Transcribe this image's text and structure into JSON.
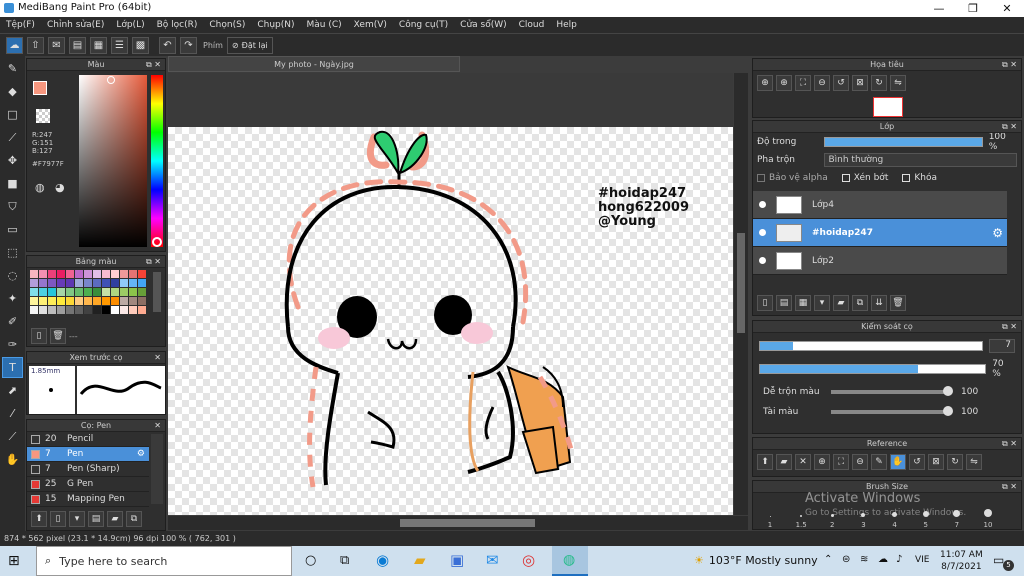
{
  "window": {
    "title": "MediBang Paint Pro (64bit)",
    "min": "—",
    "max": "❐",
    "close": "✕"
  },
  "menu": [
    "Tệp(F)",
    "Chỉnh sửa(E)",
    "Lớp(L)",
    "Bộ lọc(R)",
    "Chọn(S)",
    "Chụp(N)",
    "Màu (C)",
    "Xem(V)",
    "Công cụ(T)",
    "Cửa sổ(W)",
    "Cloud",
    "Help"
  ],
  "toolbar": {
    "phim": "Phím",
    "reset": "Đặt lại"
  },
  "color_panel": {
    "title": "Màu",
    "r": "R:247",
    "g": "G:151",
    "b": "B:127",
    "hex": "#F7977F",
    "primary": "#F7977F"
  },
  "palette_panel": {
    "title": "Bảng màu",
    "more": "---"
  },
  "preview_panel": {
    "title": "Xem trước cọ",
    "size": "1.85mm"
  },
  "brush_panel": {
    "title": "Cọ: Pen",
    "items": [
      {
        "size": "20",
        "name": "Pencil",
        "color": "#333"
      },
      {
        "size": "7",
        "name": "Pen",
        "color": "#F7977F"
      },
      {
        "size": "7",
        "name": "Pen (Sharp)",
        "color": "#333"
      },
      {
        "size": "25",
        "name": "G Pen",
        "color": "#e53935"
      },
      {
        "size": "15",
        "name": "Mapping Pen",
        "color": "#e53935"
      }
    ],
    "selected": 1
  },
  "document": {
    "tab": "My photo - Ngày.jpg"
  },
  "canvas": {
    "text1": "#hoidap247",
    "text2": "hong622009",
    "text3": "@Young"
  },
  "navigator": {
    "title": "Họa tiêu"
  },
  "layer_panel": {
    "title": "Lớp",
    "opacity_label": "Độ trong",
    "opacity_value": "100 %",
    "blend_label": "Pha trộn",
    "blend_value": "Bình thường",
    "protect_alpha": "Bảo vệ alpha",
    "clipping": "Xén bớt",
    "lock": "Khóa",
    "layers": [
      {
        "name": "Lớp4",
        "selected": false
      },
      {
        "name": "#hoidap247",
        "selected": true
      },
      {
        "name": "Lớp2",
        "selected": false
      }
    ]
  },
  "brush_control": {
    "title": "Kiểm soát cọ",
    "size_value": "7",
    "opacity_value": "70 %",
    "size_fill": 0.15,
    "opacity_fill": 0.7,
    "blend_label": "Dễ trộn màu",
    "blend_value": "100",
    "color_label": "Tài màu",
    "color_value": "100"
  },
  "reference": {
    "title": "Reference"
  },
  "brush_size": {
    "title": "Brush Size",
    "ticks": [
      "1",
      "1.5",
      "2",
      "3",
      "4",
      "5",
      "7",
      "10"
    ]
  },
  "watermark": {
    "line1": "Activate Windows",
    "line2": "Go to Settings to activate Windows."
  },
  "status": {
    "text": "874 * 562 pixel  (23.1 * 14.9cm)  96 dpi  100 %  ( 762, 301 )"
  },
  "taskbar": {
    "search": "Type here to search",
    "weather": "103°F  Mostly sunny",
    "lang": "VIE",
    "time": "11:07 AM",
    "date": "8/7/2021",
    "notif": "5"
  }
}
